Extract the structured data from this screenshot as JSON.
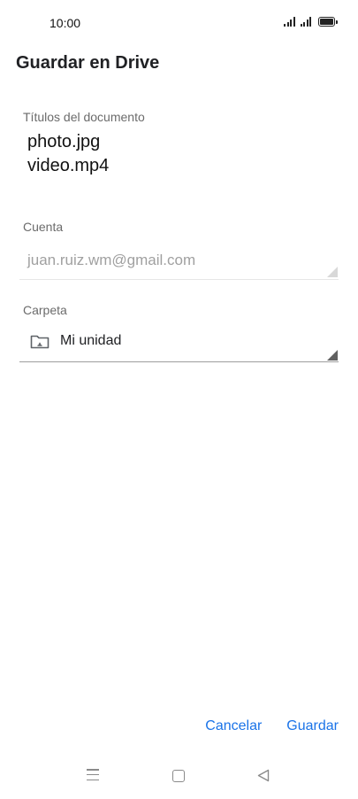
{
  "status_bar": {
    "time": "10:00",
    "icons": [
      "signal-icon",
      "signal-icon",
      "battery-icon"
    ]
  },
  "page": {
    "title": "Guardar en Drive"
  },
  "titles": {
    "label": "Títulos del documento",
    "files": [
      "photo.jpg",
      "video.mp4"
    ]
  },
  "account": {
    "label": "Cuenta",
    "value": "juan.ruiz.wm@gmail.com"
  },
  "folder": {
    "label": "Carpeta",
    "value": "Mi unidad",
    "icon": "drive-folder-icon"
  },
  "actions": {
    "cancel_label": "Cancelar",
    "save_label": "Guardar"
  },
  "nav_bar": {
    "icons": [
      "menu-icon",
      "home-icon",
      "back-icon"
    ]
  },
  "colors": {
    "accent": "#1a73e8",
    "text": "#202124",
    "label": "#6b6b6b",
    "disabled": "#a0a0a0"
  }
}
